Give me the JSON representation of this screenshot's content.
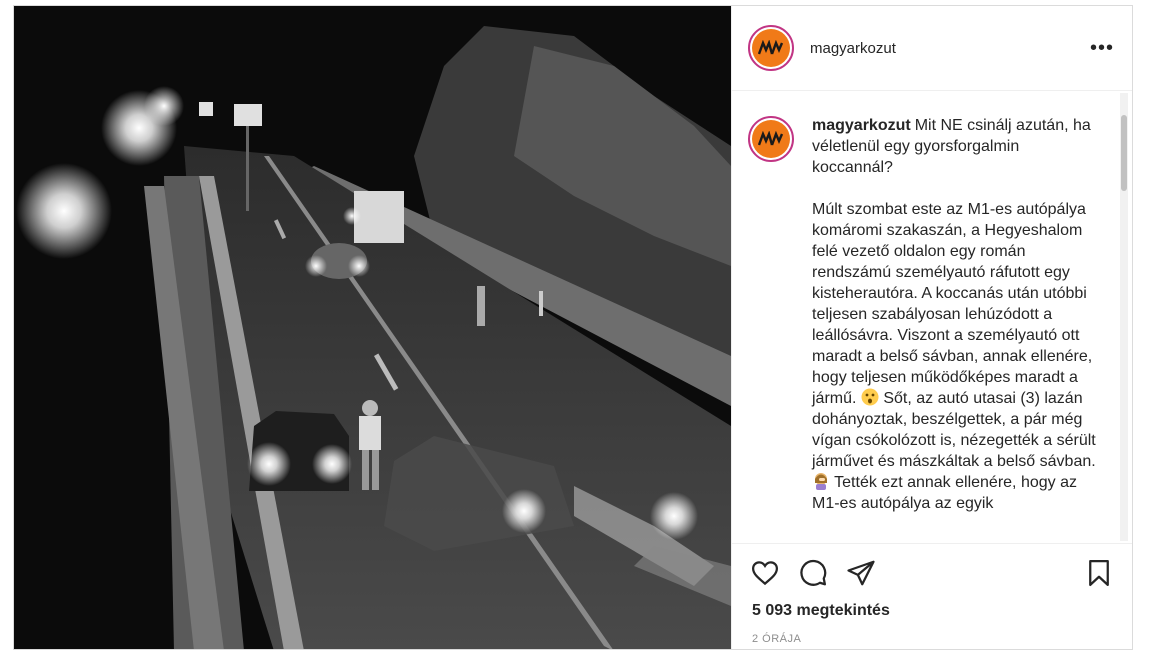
{
  "post": {
    "username": "magyarkozut",
    "header_more": "•••",
    "caption": {
      "username": "magyarkozut",
      "first_line": "Mit NE csinálj azután, ha véletlenül egy gyorsforgalmin koccannál?",
      "paragraph_part1": "Múlt szombat este az M1-es autópálya komáromi szakaszán, a Hegyeshalom felé vezető oldalon egy román rendszámú személyautó ráfutott egy kisteherautóra. A koccanás után utóbbi teljesen szabályosan lehúzódott a leállósávra. Viszont a személyautó ott maradt a belső sávban, annak ellenére, hogy teljesen működőképes maradt a jármű.",
      "paragraph_part2": "Sőt, az autó utasai (3) lazán dohányoztak, beszélgettek, a pár még vígan csókolózott is, nézegették a sérült járművet és mászkáltak a belső sávban.",
      "paragraph_part3": "Tették ezt annak ellenére, hogy az M1-es autópálya az egyik"
    },
    "emojis": [
      "astonished-face-emoji",
      "woman-facepalming-emoji"
    ],
    "views": "5 093 megtekintés",
    "time": "2 ÓRÁJA",
    "actions": [
      "like-icon",
      "comment-icon",
      "share-icon",
      "save-icon"
    ]
  },
  "colors": {
    "brand_orange": "#f07a18",
    "story_ring": "#c13584"
  }
}
